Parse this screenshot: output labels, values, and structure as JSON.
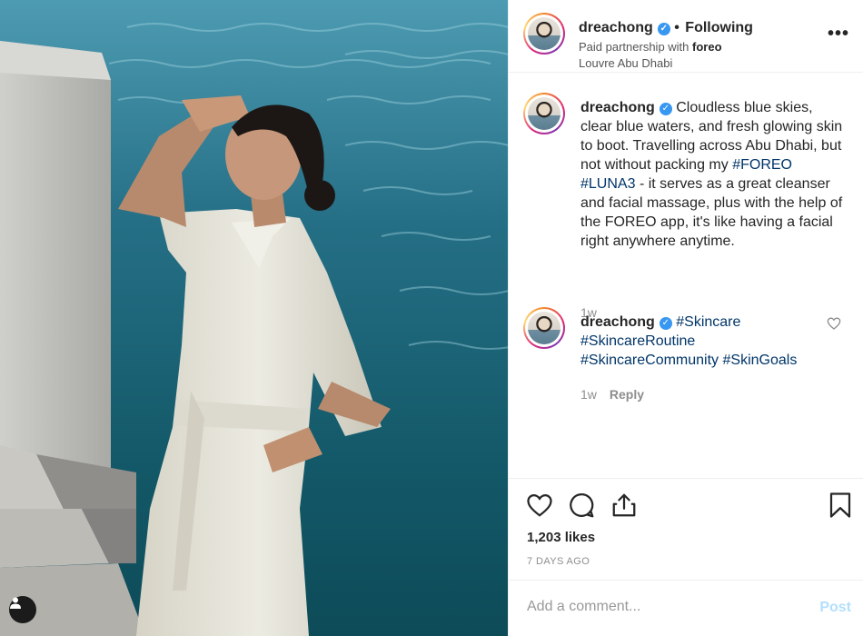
{
  "post": {
    "username": "dreachong",
    "follow_status": "Following",
    "partnership_prefix": "Paid partnership with",
    "partner": "foreo",
    "location": "Louvre Abu Dhabi"
  },
  "caption": {
    "username": "dreachong",
    "text_1": "Cloudless blue skies, clear blue waters, and fresh glowing skin to boot. Travelling across Abu Dhabi, but not without packing my",
    "tag_1": "#FOREO",
    "tag_2": "#LUNA3",
    "text_2": "- it serves as a great cleanser and facial massage, plus with the help of the FOREO app, it's like having a facial right anywhere anytime.",
    "time": "1w"
  },
  "comment": {
    "username": "dreachong",
    "tags": [
      "#Skincare",
      "#SkincareRoutine",
      "#SkincareCommunity",
      "#SkinGoals"
    ],
    "time": "1w",
    "reply_label": "Reply"
  },
  "stats": {
    "likes": "1,203 likes",
    "posted": "7 DAYS AGO"
  },
  "composer": {
    "placeholder": "Add a comment...",
    "post_label": "Post"
  },
  "icons": {
    "more": "more-options-icon",
    "like": "heart-icon",
    "comment": "comment-icon",
    "share": "share-icon",
    "save": "bookmark-icon",
    "tag": "user-tag-icon"
  },
  "colors": {
    "hashtag": "#003569",
    "verified": "#3897f0",
    "post_disabled": "#b2dffc"
  }
}
